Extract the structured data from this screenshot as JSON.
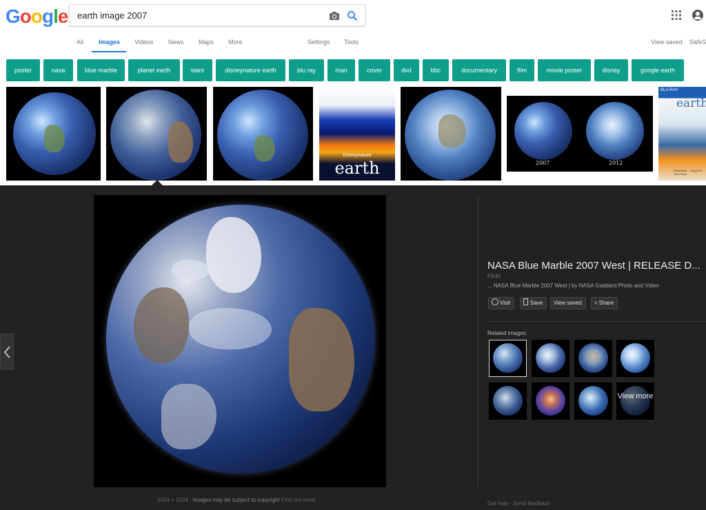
{
  "header": {
    "logo": [
      "G",
      "o",
      "o",
      "g",
      "l",
      "e"
    ],
    "logo_colors": [
      "#4285F4",
      "#EA4335",
      "#FBBC05",
      "#4285F4",
      "#34A853",
      "#EA4335"
    ],
    "query": "earth image 2007"
  },
  "nav": {
    "tabs": [
      "All",
      "Images",
      "Videos",
      "News",
      "Maps",
      "More"
    ],
    "active_tab": "Images",
    "settings": "Settings",
    "tools": "Tools",
    "view_saved": "View saved",
    "safesearch": "SafeS"
  },
  "chips": [
    "poster",
    "nasa",
    "blue marble",
    "planet earth",
    "stars",
    "disneynature earth",
    "blu ray",
    "man",
    "cover",
    "dvd",
    "bbc",
    "documentary",
    "film",
    "movie poster",
    "disney",
    "google earth"
  ],
  "thumbs": {
    "year_left": "2007",
    "year_right": "2012",
    "poster_title": "earth",
    "poster_brand": "Disneynature",
    "bluray_brand": "BLU-RAY",
    "bluray_title": "earth",
    "bluray_tagline": "Remember ... Much Of The Planet"
  },
  "viewer": {
    "title": "NASA Blue Marble 2007 West | RELEASE D...",
    "source": "Flickr",
    "description": "... NASA Blue Marble 2007 West | by NASA Goddard Photo and Video",
    "actions": [
      "Visit",
      "Save",
      "View saved",
      "Share"
    ],
    "related_label": "Related images:",
    "view_more": "View more",
    "image_size": "1024 × 1024",
    "copyright": "Images may be subject to copyright",
    "find_out_more": "Find out more",
    "get_help": "Get help",
    "send_feedback": "Send feedback",
    "separator": "-"
  },
  "colors": {
    "accent": "#1a73e8",
    "chip_bg": "#0f9d8c",
    "panel_bg": "#222222"
  }
}
